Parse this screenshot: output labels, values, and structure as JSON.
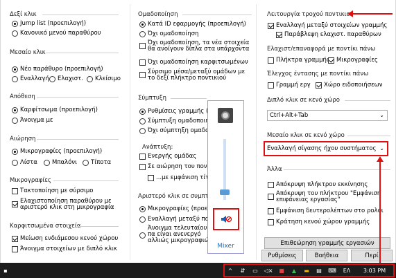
{
  "col1": {
    "right_click": {
      "title": "Δεξί κλικ",
      "opt1": "Jump list (προεπιλογή)",
      "opt2": "Κανονικό μενού παραθύρου"
    },
    "middle_click": {
      "title": "Μεσαίο κλικ",
      "opt1": "Νέο παράθυρο (προεπιλογή)",
      "opt2": "Εναλλαγή",
      "opt3": "Ελαχιστ.",
      "opt4": "Κλείσιμο"
    },
    "drop": {
      "title": "Απόθεση",
      "opt1": "Καρφίτσωμα (προεπιλογή)",
      "opt2": "Άνοιγμα με"
    },
    "hover": {
      "title": "Αιώρηση",
      "opt1": "Μικρογραφίες (προεπιλογή)",
      "opt2": "Λίστα",
      "opt3": "Μπαλόνι",
      "opt4": "Τίποτα"
    },
    "thumbnails": {
      "title": "Μικρογραφίες",
      "chk1": "Τακτοποίηση με σύρσιμο",
      "chk2": "Ελαχιστοποίηση παραθύρου με αριστερό κλικ στη μικρογραφία"
    },
    "pinned": {
      "title": "Καρφιτσωμένα στοιχεία",
      "chk1": "Μείωση ενδιάμεσου κενού χώρου",
      "chk2": "Άνοιγμα στοιχείων με διπλό κλικ"
    }
  },
  "col2": {
    "grouping": {
      "title": "Ομαδοποίηση",
      "opt1": "Κατά ID εφαρμογής (προεπιλογή)",
      "opt2": "Όχι ομαδοποίηση",
      "chk1": "Όχι ομαδοποίηση, τα νέα στοιχεία θα ανοίγουν δίπλα στα υπάρχοντα",
      "chk2": "Όχι ομαδοποίηση καρφιτσωμένων",
      "chk3": "Σύρσιμο μέσα/μεταξύ ομάδων με το δεξί πλήκτρο ποντικιού"
    },
    "combine": {
      "title": "Σύμπτυξη",
      "opt1": "Ρυθμίσεις γραμμής (π",
      "opt2": "Σύμπτυξη ομαδοποιημ",
      "opt3": "Όχι σύμπτηξη ομαδοπ"
    },
    "expand": {
      "title": "Ανάπτυξη:",
      "chk1": "Ενεργής ομάδας",
      "chk2": "Σε αιώρηση του ποντικ",
      "chk3": "...με εμφάνιση τίτλ"
    },
    "leftclick": {
      "title": "Αριστερό κλικ σε συμπτυγ",
      "opt1": "Μικρογραφίες (προεπι",
      "opt2": "Εναλλαγή μεταξύ παρ",
      "text": "Άνοιγμα τελευταίου πα είναι ανενεργό αλλιώς μικρογραφιών"
    }
  },
  "mixer": {
    "label": "Mixer"
  },
  "col3": {
    "wheel": {
      "title": "Λειτουργία τροχού ποντικιού",
      "chk1": "Εναλλαγή μεταξύ στοιχείων γραμμής",
      "chk2": "Παράβλεψη ελαχιστ. παραθύρων"
    },
    "min_restore": {
      "title": "Ελαχιστ/επαναφορά με ποντίκι πάνω",
      "chk1": "Πλήκτρα γραμμής",
      "chk2": "Μικρογραφίες"
    },
    "volume": {
      "title": "Έλεγχος έντασης με ποντίκι πάνω",
      "chk1": "Γραμμή εργ",
      "chk2": "Χώρο ειδοποιήσεων"
    },
    "dbl_click": {
      "title": "Διπλό κλικ σε κενό χώρο",
      "value": "Ctrl+Alt+Tab"
    },
    "mid_click": {
      "title": "Μεσαίο κλικ σε κενό χώρο",
      "value": "Εναλλαγή σίγασης ήχου συστήματος"
    },
    "other": {
      "title": "Άλλα",
      "chk1": "Απόκρυψη πλήκτρου εκκίνησης",
      "chk2": "Απόκρυψη του πλήκτρου \"Εμφάνιση επιφάνειας εργασίας\"",
      "chk3": "Εμφάνιση δευτερολέπτων στο ρολόι",
      "chk4": "Κράτηση κενού χώρου γραμμής"
    },
    "inspect_btn": "Επιθεώρηση γραμμής εργασιών"
  },
  "buttons": {
    "settings": "Ρυθμίσεις",
    "help": "Βοήθεια",
    "about": "Περί"
  },
  "taskbar": {
    "lang": "ΕΛ",
    "time": "3:03 PM"
  }
}
